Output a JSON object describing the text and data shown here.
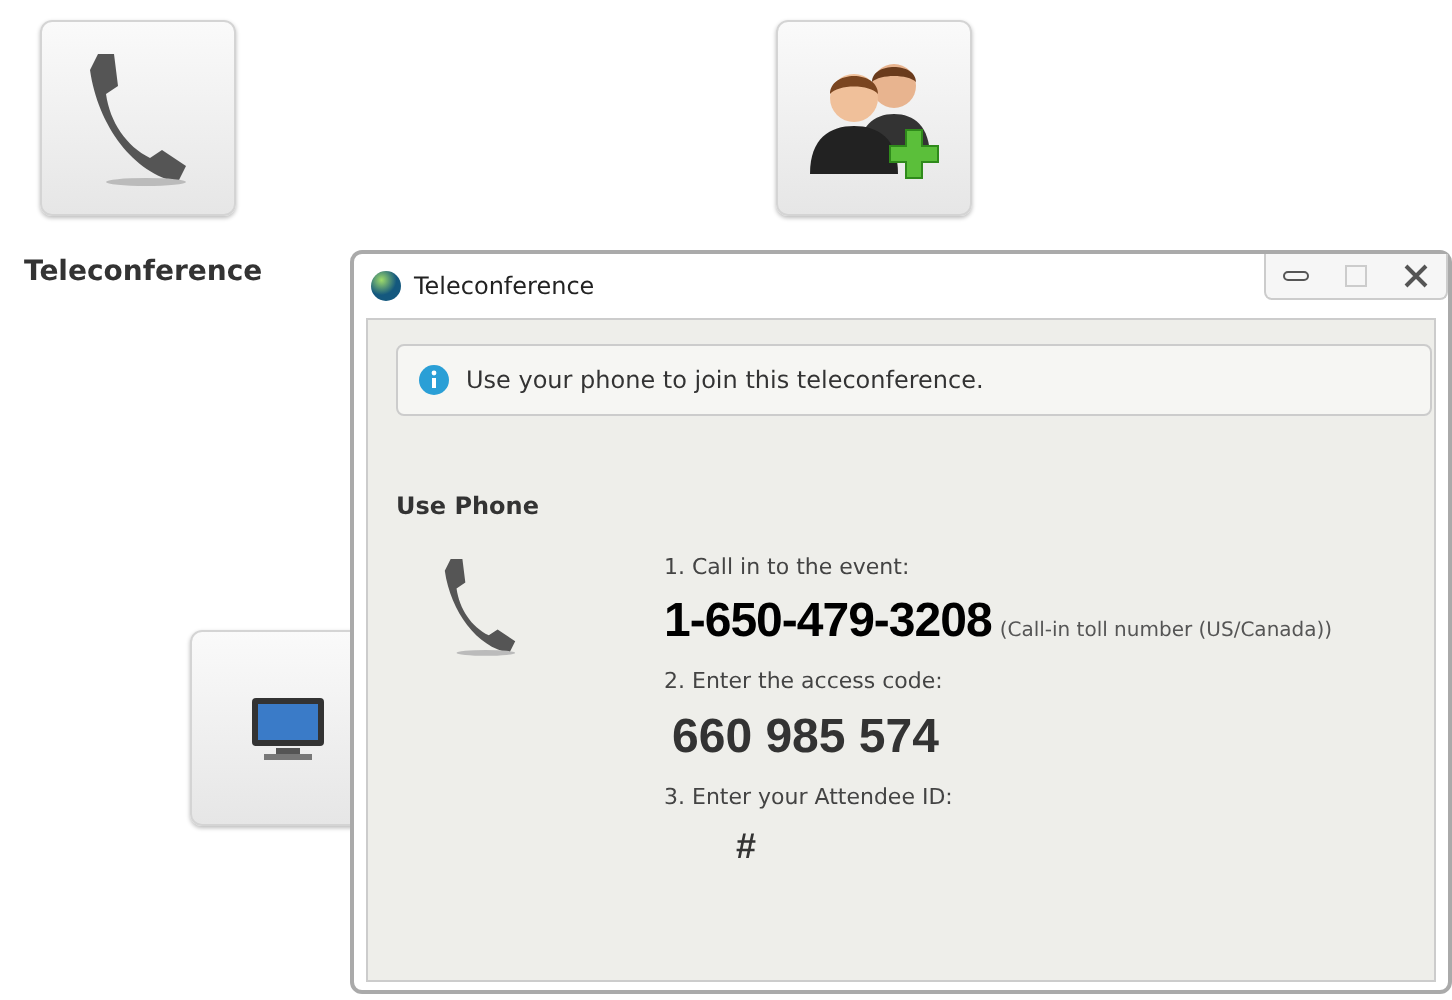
{
  "desktop": {
    "tiles": [
      {
        "kind": "phone",
        "label": "Teleconference"
      },
      {
        "kind": "add-people"
      },
      {
        "kind": "monitor"
      }
    ]
  },
  "window": {
    "title": "Teleconference",
    "info": "Use your phone to join this teleconference.",
    "section": "Use Phone",
    "steps": [
      {
        "label": "1. Call in to the event:",
        "value": "1-650-479-3208",
        "note": "(Call-in toll number (US/Canada))",
        "kind": "phone"
      },
      {
        "label": "2. Enter the access code:",
        "value": "660 985 574",
        "kind": "code"
      },
      {
        "label": "3. Enter your Attendee ID:",
        "value": "#",
        "kind": "hash"
      }
    ]
  }
}
